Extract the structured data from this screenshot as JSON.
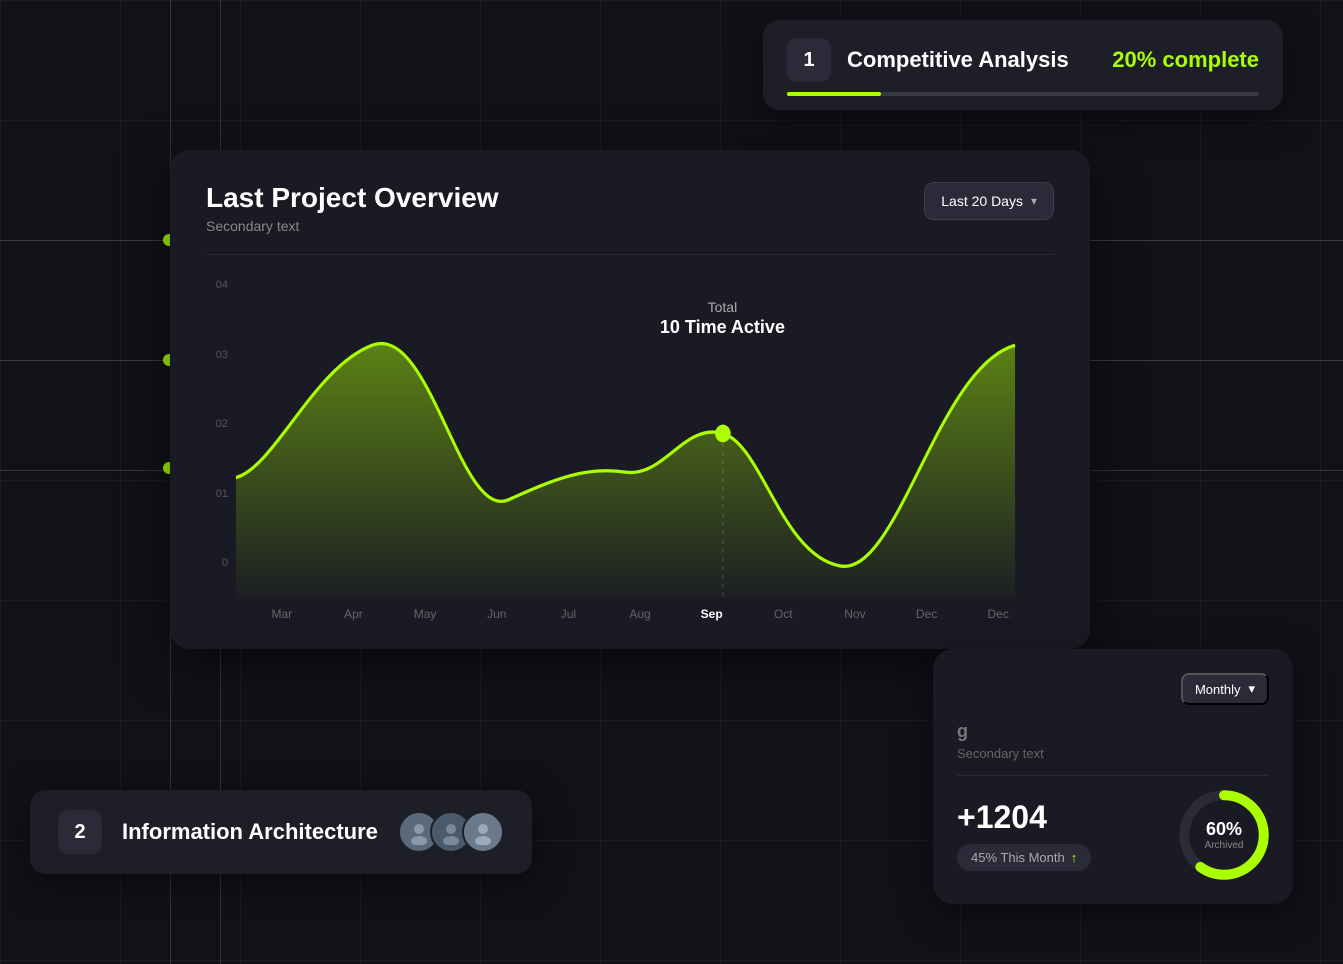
{
  "competitive_analysis": {
    "step": "1",
    "title": "Competitive Analysis",
    "percent_label": "20% complete",
    "progress": 20
  },
  "chart": {
    "title": "Last Project Overview",
    "subtitle": "Secondary text",
    "dropdown_label": "Last 20 Days",
    "tooltip": {
      "label": "Total",
      "value": "10 Time Active"
    },
    "y_labels": [
      "04",
      "03",
      "02",
      "01",
      "0"
    ],
    "x_labels": [
      "Mar",
      "Apr",
      "May",
      "Jun",
      "Jul",
      "Aug",
      "Sep",
      "Oct",
      "Nov",
      "Dec",
      "Dec"
    ],
    "active_x": "Sep"
  },
  "bottom_right": {
    "dropdown_label": "Monthly",
    "card_title": "g",
    "secondary_text": "Secondary text",
    "stat_number": "+1204",
    "stat_tag": "45% This Month",
    "donut_percent": "60%",
    "donut_label": "Archived"
  },
  "info_arch": {
    "step": "2",
    "title": "Information Architecture",
    "avatars": [
      "👤",
      "👤",
      "👤"
    ]
  }
}
